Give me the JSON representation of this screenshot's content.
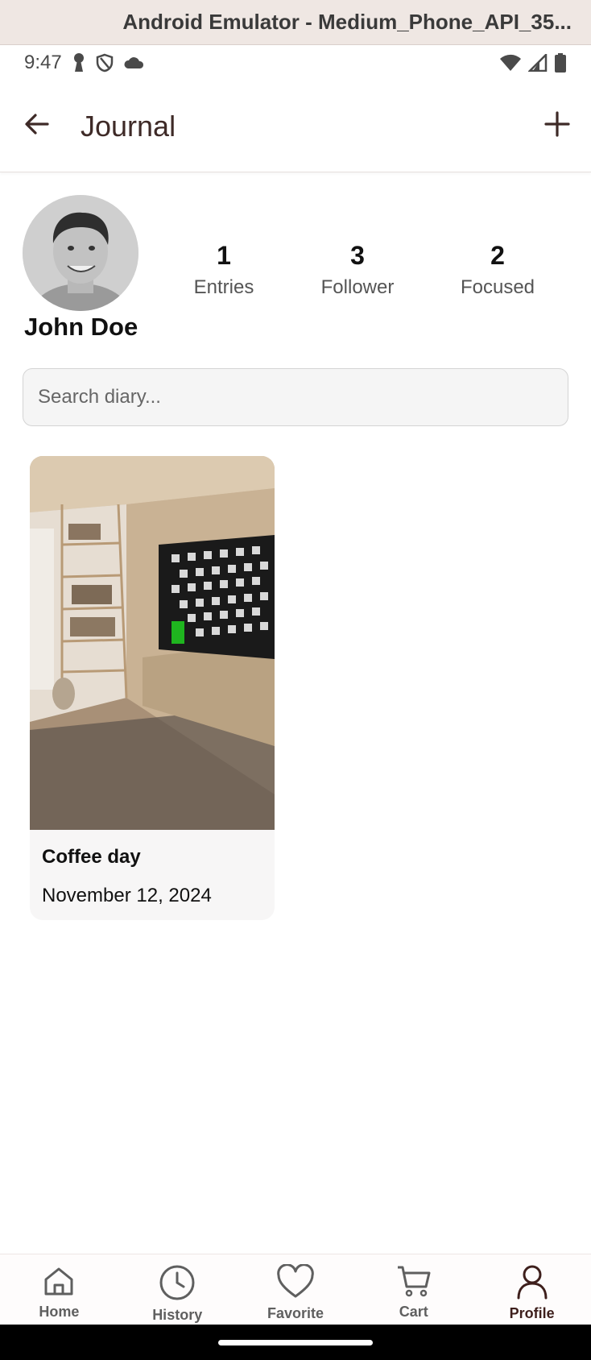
{
  "window": {
    "title": "Android Emulator - Medium_Phone_API_35..."
  },
  "status_bar": {
    "time": "9:47",
    "left_icons": [
      "keyhole-icon",
      "shield-icon",
      "cloud-icon"
    ],
    "right_icons": [
      "wifi-icon",
      "signal-icon",
      "battery-icon"
    ]
  },
  "app_bar": {
    "title": "Journal",
    "back_icon": "arrow-left-icon",
    "add_icon": "plus-icon",
    "accent": "#3e2a27"
  },
  "profile": {
    "name": "John Doe",
    "stats": [
      {
        "value": "1",
        "label": "Entries"
      },
      {
        "value": "3",
        "label": "Follower"
      },
      {
        "value": "2",
        "label": "Focused"
      }
    ]
  },
  "search": {
    "placeholder": "Search diary..."
  },
  "entries": [
    {
      "title": "Coffee day",
      "date": "November 12, 2024"
    }
  ],
  "bottom_nav": {
    "items": [
      {
        "label": "Home",
        "icon": "home-icon"
      },
      {
        "label": "History",
        "icon": "clock-icon"
      },
      {
        "label": "Favorite",
        "icon": "heart-icon"
      },
      {
        "label": "Cart",
        "icon": "cart-icon"
      },
      {
        "label": "Profile",
        "icon": "person-icon",
        "active": true
      }
    ],
    "active_color": "#3e1f1c",
    "inactive_color": "#5f5f5f"
  }
}
